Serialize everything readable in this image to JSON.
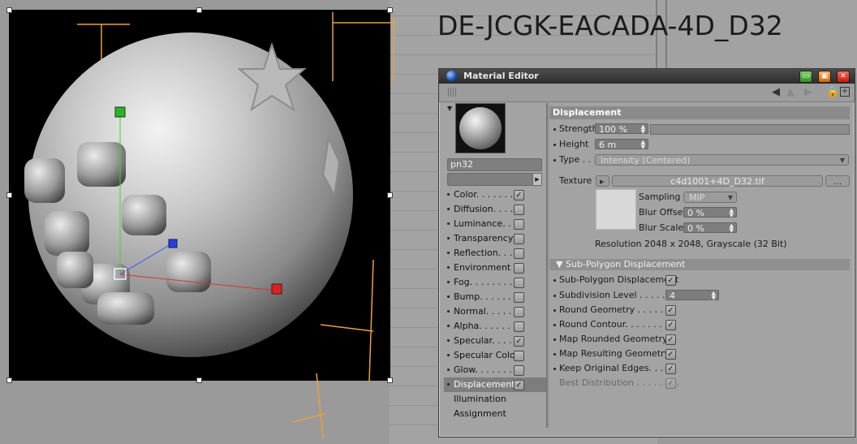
{
  "viewport": {
    "title": "DE-JCGK-EACADA-4D_D32"
  },
  "material_editor": {
    "window_title": "Material Editor",
    "material_name": "pn32",
    "channels": [
      {
        "label": "Color",
        "dots": ". . . . . . .",
        "checked": true
      },
      {
        "label": "Diffusion",
        "dots": ". . . . .",
        "checked": false
      },
      {
        "label": "Luminance",
        "dots": ". . .",
        "checked": false
      },
      {
        "label": "Transparency",
        "dots": "",
        "checked": false
      },
      {
        "label": "Reflection",
        "dots": ". . .",
        "checked": false
      },
      {
        "label": "Environment",
        "dots": "",
        "checked": false
      },
      {
        "label": "Fog",
        "dots": ". . . . . . . . .",
        "checked": false
      },
      {
        "label": "Bump",
        "dots": ". . . . . . .",
        "checked": false
      },
      {
        "label": "Normal",
        "dots": ". . . . . .",
        "checked": false
      },
      {
        "label": "Alpha",
        "dots": ". . . . . . .",
        "checked": false
      },
      {
        "label": "Specular",
        "dots": ". . . . .",
        "checked": true
      },
      {
        "label": "Specular Color",
        "dots": "",
        "checked": false
      },
      {
        "label": "Glow",
        "dots": ". . . . . . . .",
        "checked": false
      },
      {
        "label": "Displacement",
        "dots": "",
        "checked": true,
        "active": true
      },
      {
        "label": "Illumination",
        "dots": "",
        "checked": null
      },
      {
        "label": "Assignment",
        "dots": "",
        "checked": null
      }
    ],
    "displacement": {
      "header": "Displacement",
      "strength_label": "Strength",
      "strength_value": "100 %",
      "height_label": "Height",
      "height_value": "6 m",
      "type_label": "Type . . .",
      "type_value": "Intensity (Centered)",
      "texture_label": "Texture",
      "texture_file": "c4d1001+4D_D32.tif",
      "texture_more": "...",
      "sampling_label": "Sampling",
      "sampling_value": "MIP",
      "blur_offset_label": "Blur Offset",
      "blur_offset_value": "0 %",
      "blur_scale_label": "Blur Scale",
      "blur_scale_value": "0 %",
      "resolution_text": "Resolution 2048 x 2048, Grayscale (32 Bit)",
      "subpoly_header": "Sub-Polygon Displacement",
      "options": [
        {
          "label": "Sub-Polygon Displacement",
          "checked": true
        },
        {
          "label": "Subdivision Level . . . . . . .",
          "field": "4"
        },
        {
          "label": "Round Geometry . . . . . . .",
          "checked": true
        },
        {
          "label": "Round Contour. . . . . . . .",
          "checked": true
        },
        {
          "label": "Map Rounded Geometry .",
          "checked": true
        },
        {
          "label": "Map Resulting Geometry .",
          "checked": true
        },
        {
          "label": "Keep Original Edges. . . . .",
          "checked": true
        },
        {
          "label": "Best Distribution . . . . . . . .",
          "checked": true,
          "disabled": true
        }
      ]
    }
  },
  "colors": {
    "accent": "#7d7d7d",
    "titlebar": "#2c2c2c",
    "render_bg": "#000000"
  }
}
